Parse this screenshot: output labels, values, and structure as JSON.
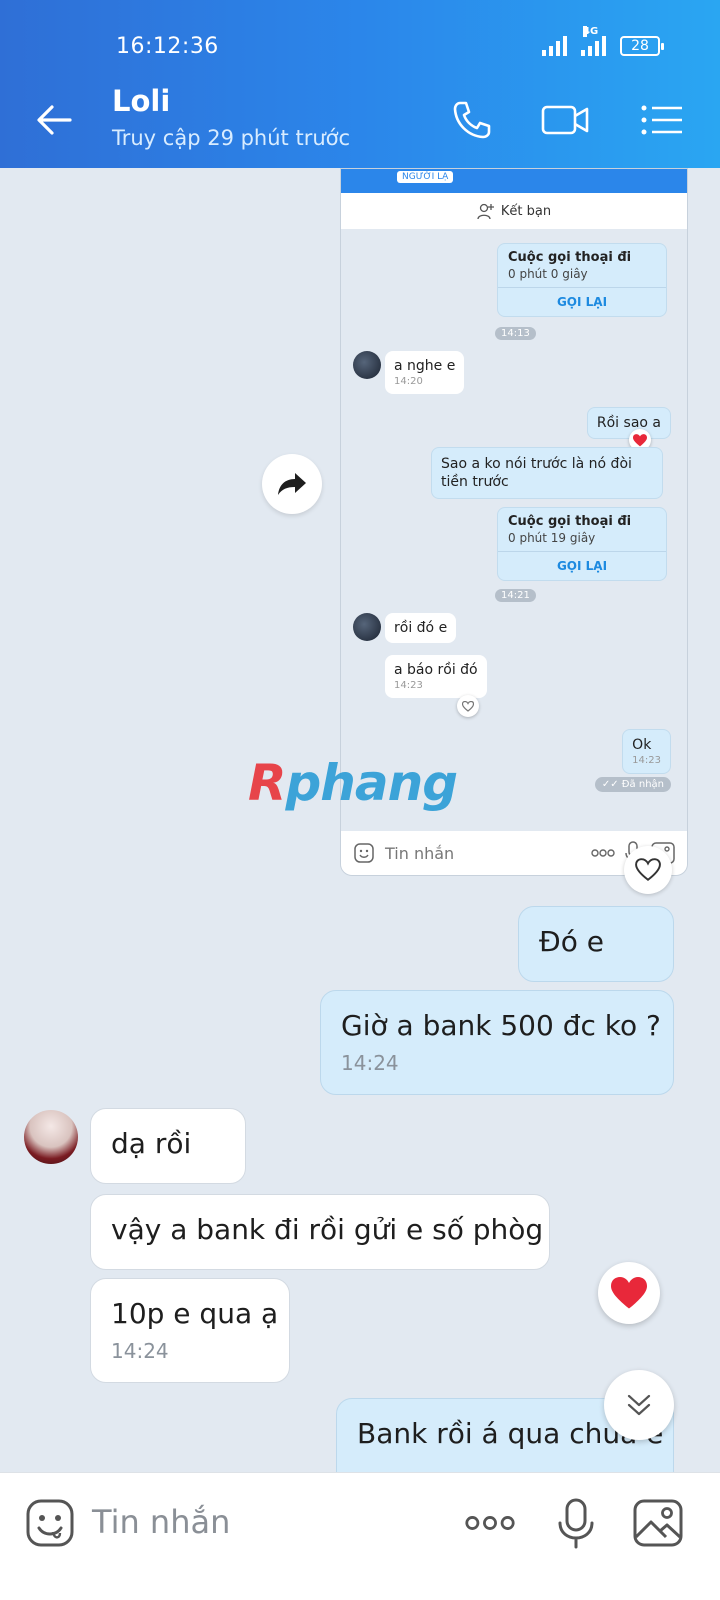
{
  "status_bar": {
    "time": "16:12:36",
    "network": "4G",
    "battery": "28"
  },
  "header": {
    "name": "Loli",
    "subtitle": "Truy cập 29 phút trước"
  },
  "shared_screenshot": {
    "badge": "NGƯỜI LẠ",
    "add_friend_label": "Kết bạn",
    "call1": {
      "title": "Cuộc gọi thoại đi",
      "duration": "0 phút 0 giây",
      "action": "GỌI LẠI"
    },
    "time1": "14:13",
    "msg_nghe": {
      "text": "a nghe e",
      "time": "14:20"
    },
    "msg_roi_sao": "Rồi sao a",
    "msg_sao_ko": "Sao a ko nói trước là nó đòi tiền trước",
    "call2": {
      "title": "Cuộc gọi thoại đi",
      "duration": "0 phút 19 giây",
      "action": "GỌI LẠI"
    },
    "time2": "14:21",
    "msg_roi_do": "rồi đó e",
    "msg_bao": {
      "text": "a báo rồi đó",
      "time": "14:23"
    },
    "msg_ok": {
      "text": "Ok",
      "time": "14:23"
    },
    "status": "Đã nhận",
    "input_placeholder": "Tin nhắn"
  },
  "watermark": {
    "first": "R",
    "rest": "phang"
  },
  "messages": [
    {
      "id": "m1",
      "text": "Đó e"
    },
    {
      "id": "m2",
      "text": "Giờ a bank 500 đc ko ?",
      "time": "14:24"
    },
    {
      "id": "m3",
      "text": "dạ rồi"
    },
    {
      "id": "m4",
      "text": "vậy a bank đi rồi gửi e số phòg"
    },
    {
      "id": "m5",
      "text": "10p e qua ạ",
      "time": "14:24"
    },
    {
      "id": "m6",
      "text": "Bank rồi á qua chưa e"
    }
  ],
  "composer": {
    "placeholder": "Tin nhắn"
  },
  "colors": {
    "header_start": "#2f6fd6",
    "header_end": "#2aa6f2",
    "my_bubble": "#d5ecfb",
    "background": "#e2e9f1",
    "heart": "#e8283a"
  }
}
